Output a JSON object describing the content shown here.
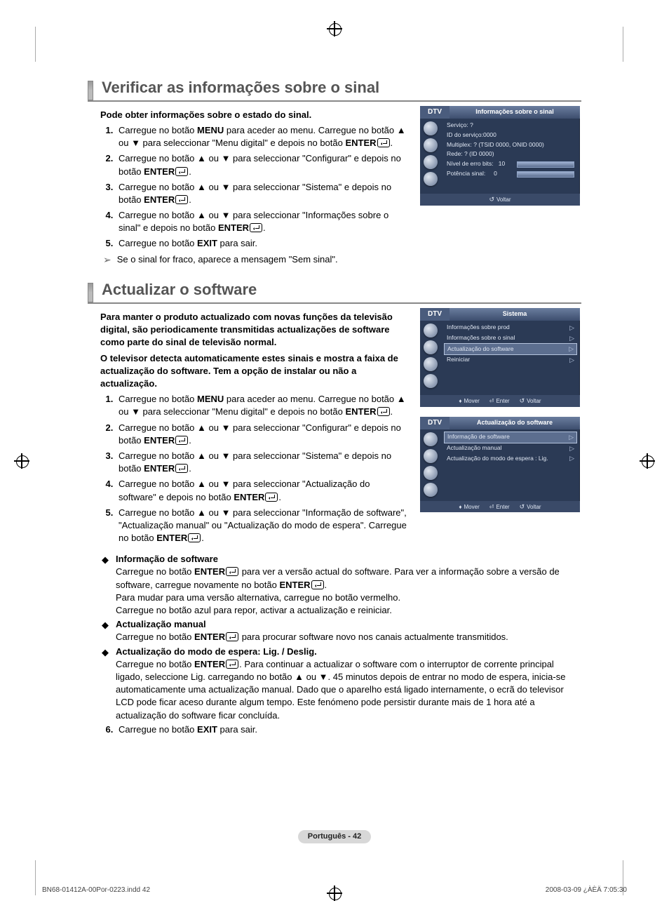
{
  "heading1": "Verificar as informações sobre o sinal",
  "intro1": "Pode obter informações sobre o estado do sinal.",
  "steps1": [
    "Carregue no botão MENU para aceder ao menu. Carregue no botão ▲ ou ▼ para seleccionar \"Menu digital\" e depois no botão ENTER.",
    "Carregue no botão ▲ ou ▼ para seleccionar \"Configurar\" e depois no botão ENTER.",
    "Carregue no botão ▲ ou ▼ para seleccionar \"Sistema\" e depois no botão ENTER.",
    "Carregue no botão ▲ ou ▼ para seleccionar \"Informações sobre o sinal\" e depois no botão ENTER.",
    "Carregue no botão EXIT para sair."
  ],
  "note1": "Se o sinal for fraco, aparece a mensagem \"Sem sinal\".",
  "osd1": {
    "tab": "DTV",
    "title": "Informações sobre o sinal",
    "lines": {
      "servico": "Serviço: ?",
      "id": "ID do serviço:0000",
      "multiplex": "Multiplex: ? (TSID 0000, ONID 0000)",
      "rede": "Rede: ? (ID 0000)",
      "erro_label": "Nível de erro bits:",
      "erro_val": "10",
      "potencia_label": "Potência sinal:",
      "potencia_val": "0"
    },
    "footer_return": "Voltar"
  },
  "heading2": "Actualizar o software",
  "intro2a": "Para manter o produto actualizado com novas funções da televisão digital, são periodicamente transmitidas actualizações de software como parte do sinal de televisão normal.",
  "intro2b": "O televisor detecta automaticamente estes sinais e mostra a faixa de actualização do software. Tem a opção de instalar ou não a actualização.",
  "steps2": [
    "Carregue no botão MENU para aceder ao menu. Carregue no botão ▲ ou ▼ para seleccionar \"Menu digital\" e depois no botão ENTER.",
    "Carregue no botão ▲ ou ▼ para seleccionar \"Configurar\" e depois no botão ENTER.",
    "Carregue no botão ▲ ou ▼ para seleccionar \"Sistema\" e depois no botão ENTER.",
    "Carregue no botão ▲ ou ▼ para seleccionar \"Actualização do software\" e depois no botão ENTER.",
    "Carregue no botão ▲ ou ▼ para seleccionar \"Informação de software\", \"Actualização manual\" ou \"Actualização do modo de espera\". Carregue no botão ENTER."
  ],
  "bullets": [
    {
      "title": "Informação de software",
      "body": "Carregue no botão ENTER para ver a versão actual do software. Para ver a informação sobre a versão de software, carregue novamente no botão ENTER.\nPara mudar para uma versão alternativa, carregue no botão vermelho.\nCarregue no botão azul para repor, activar a actualização e reiniciar."
    },
    {
      "title": "Actualização manual",
      "body": "Carregue no botão ENTER para procurar software novo nos canais actualmente transmitidos."
    },
    {
      "title": "Actualização do modo de espera: Lig. / Deslig.",
      "body": "Carregue no botão ENTER. Para continuar a actualizar o software com o interruptor de corrente principal ligado, seleccione Lig. carregando no botão ▲ ou ▼. 45 minutos depois de entrar no modo de espera, inicia-se automaticamente uma actualização manual. Dado que o aparelho está ligado internamente, o ecrã do televisor LCD pode ficar aceso durante algum tempo. Este fenómeno pode persistir durante mais de 1 hora até a actualização do software ficar concluída."
    }
  ],
  "step6": "Carregue no botão EXIT para sair.",
  "osd2": {
    "tab": "DTV",
    "title": "Sistema",
    "items": [
      "Informações sobre prod",
      "Informações sobre o sinal",
      "Actualização do software",
      "Reiniciar"
    ],
    "selected_index": 2,
    "footer_move": "Mover",
    "footer_enter": "Enter",
    "footer_return": "Voltar"
  },
  "osd3": {
    "tab": "DTV",
    "title": "Actualização do software",
    "items": [
      "Informação de software",
      "Actualização manual",
      "Actualização do modo de espera : Lig."
    ],
    "selected_index": 0,
    "footer_move": "Mover",
    "footer_enter": "Enter",
    "footer_return": "Voltar"
  },
  "footer_lang": "Português - 42",
  "meta_file": "BN68-01412A-00Por-0223.indd   42",
  "meta_time": "2008-03-09   ¿ÀÈÄ 7:05:30"
}
